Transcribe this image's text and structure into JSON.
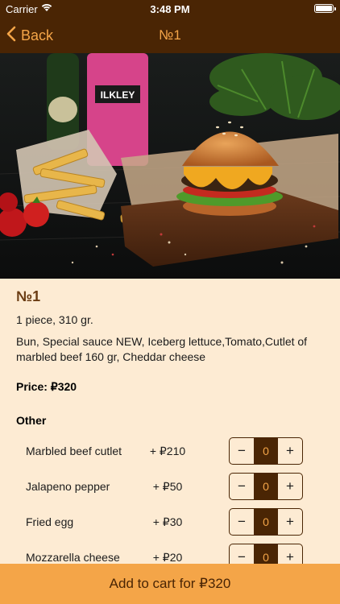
{
  "status": {
    "carrier": "Carrier",
    "time": "3:48 PM"
  },
  "nav": {
    "back_label": "Back",
    "title": "№1"
  },
  "item": {
    "title": "№1",
    "portion": "1 piece, 310 gr.",
    "ingredients": "Bun, Special sauce NEW, Iceberg lettuce,Tomato,Cutlet of marbled beef 160 gr, Cheddar cheese",
    "price": "Price: ₽320"
  },
  "other": {
    "title": "Other",
    "items": [
      {
        "name": "Marbled beef cutlet",
        "price": "+ ₽210",
        "count": "0"
      },
      {
        "name": "Jalapeno pepper",
        "price": "+ ₽50",
        "count": "0"
      },
      {
        "name": "Fried egg",
        "price": "+ ₽30",
        "count": "0"
      },
      {
        "name": "Mozzarella cheese",
        "price": "+ ₽20",
        "count": "0"
      }
    ]
  },
  "stepper": {
    "minus": "−",
    "plus": "+"
  },
  "cart": {
    "label": "Add to cart for ₽320"
  },
  "colors": {
    "nav_bg": "#4A2504",
    "accent": "#F4A548",
    "page_bg": "#FDEBD3"
  },
  "hero_image": {
    "beer_label_text": "ILKLEY"
  }
}
